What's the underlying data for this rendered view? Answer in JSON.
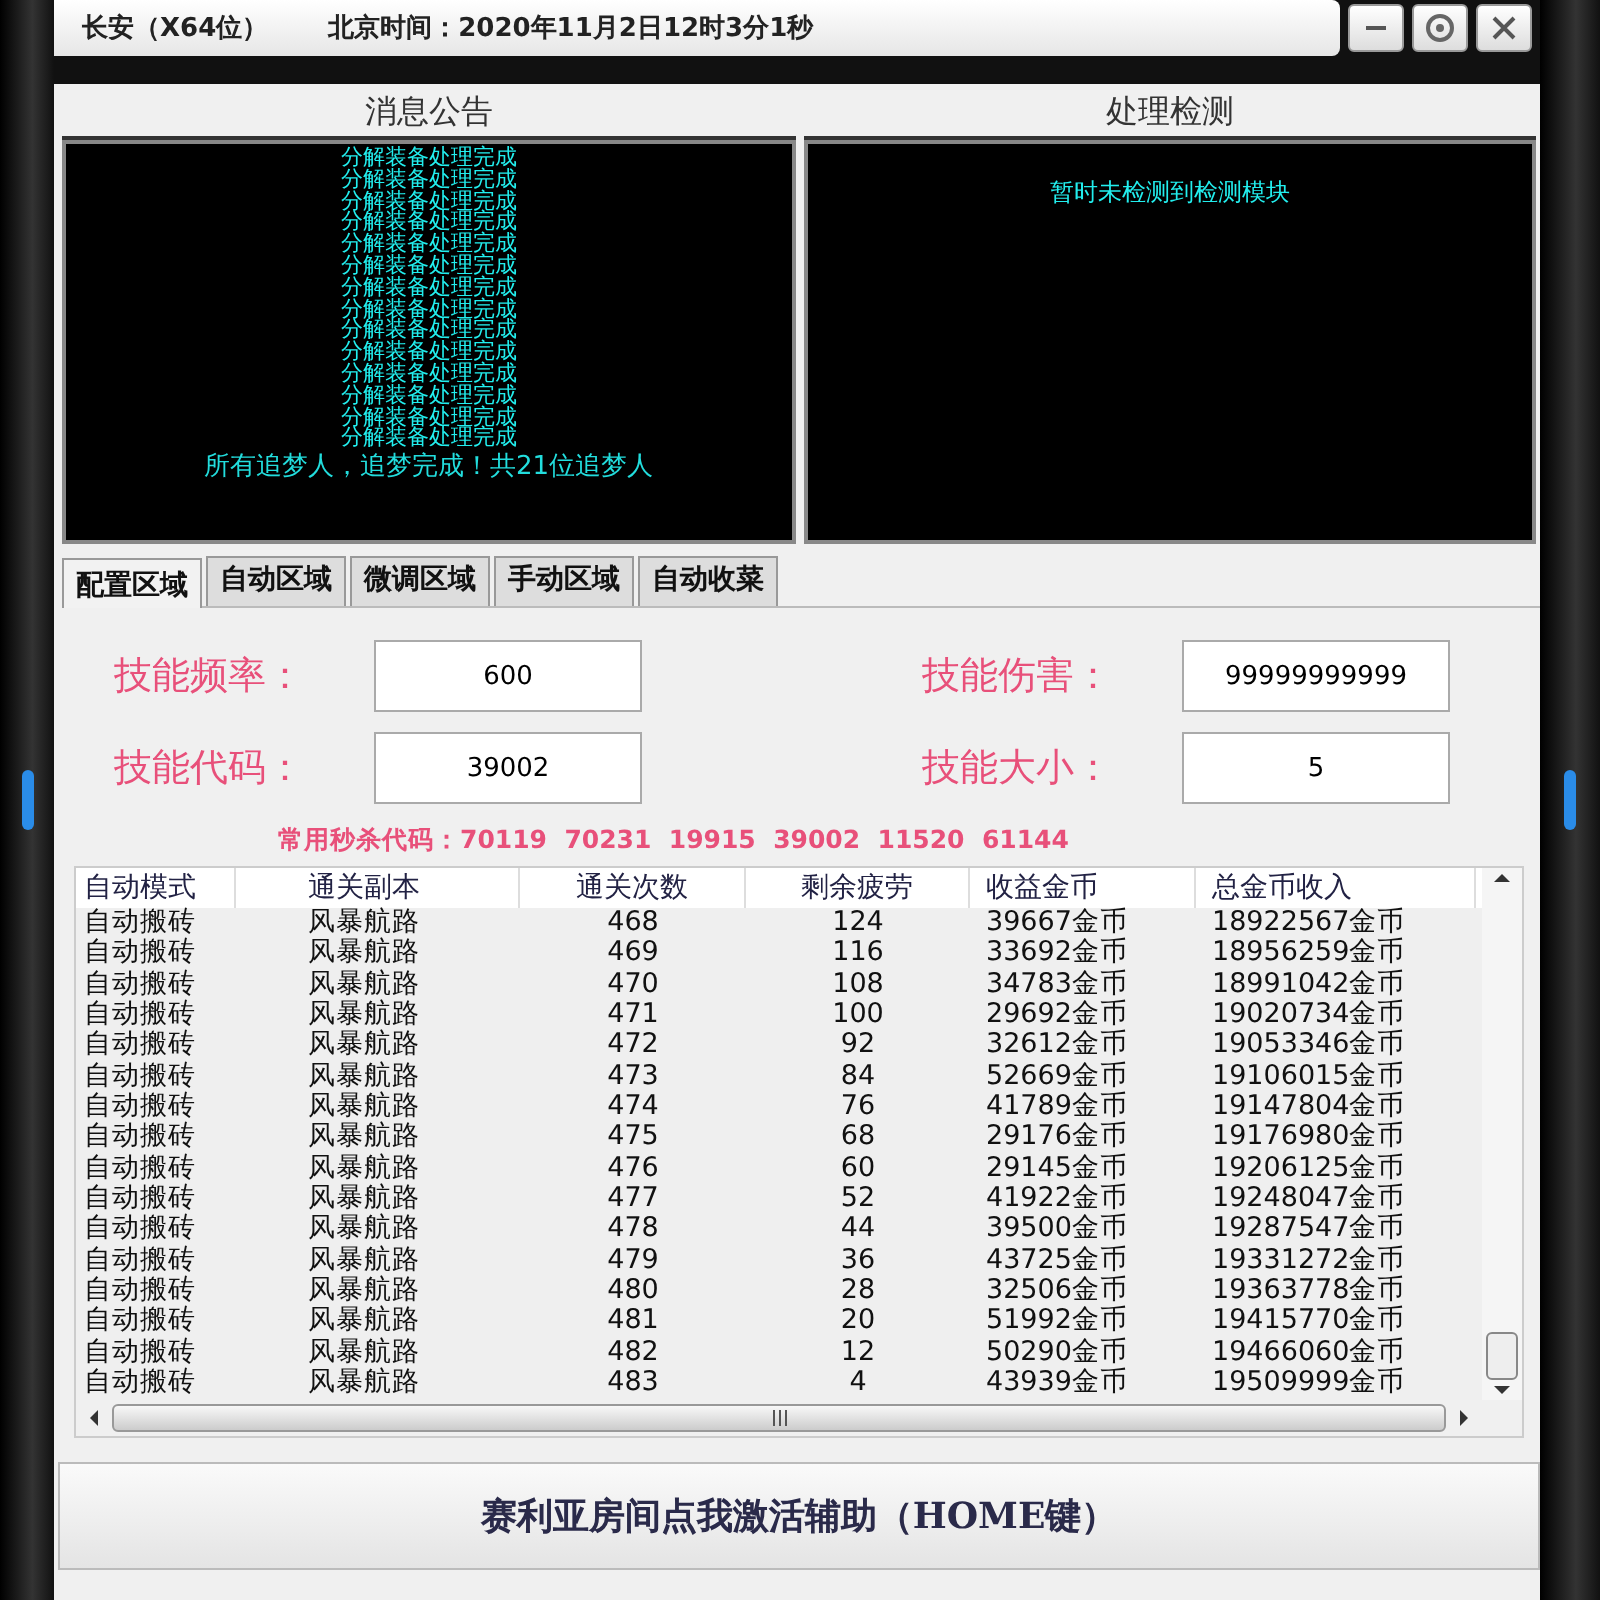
{
  "window": {
    "title": "长安（X64位）",
    "clock": "北京时间：2020年11月2日12时3分1秒"
  },
  "panels": [
    {
      "title": "消息公告",
      "lines": [
        "分解装备处理完成",
        "分解装备处理完成",
        "分解装备处理完成",
        "分解装备处理完成",
        "分解装备处理完成",
        "分解装备处理完成",
        "分解装备处理完成",
        "分解装备处理完成",
        "分解装备处理完成",
        "分解装备处理完成",
        "分解装备处理完成",
        "分解装备处理完成",
        "分解装备处理完成",
        "分解装备处理完成"
      ],
      "footer": "所有追梦人，追梦完成！共21位追梦人"
    },
    {
      "title": "处理检测",
      "lines": [
        "暂时未检测到检测模块"
      ]
    }
  ],
  "tabs": [
    {
      "label": "配置区域",
      "selected": true
    },
    {
      "label": "自动区域",
      "selected": false
    },
    {
      "label": "微调区域",
      "selected": false
    },
    {
      "label": "手动区域",
      "selected": false
    },
    {
      "label": "自动收菜",
      "selected": false
    }
  ],
  "fields": [
    {
      "label": "技能频率：",
      "value": "600"
    },
    {
      "label": "技能伤害：",
      "value": "99999999999"
    },
    {
      "label": "技能代码：",
      "value": "39002"
    },
    {
      "label": "技能大小：",
      "value": "5"
    }
  ],
  "hint": "常用秒杀代码：70119  70231  19915  39002  11520  61144",
  "table": {
    "columns": [
      "自动模式",
      "通关副本",
      "通关次数",
      "剩余疲劳",
      "收益金币",
      "总金币收入"
    ],
    "rows": [
      [
        "自动搬砖",
        "风暴航路",
        "468",
        "124",
        "39667金币",
        "18922567金币"
      ],
      [
        "自动搬砖",
        "风暴航路",
        "469",
        "116",
        "33692金币",
        "18956259金币"
      ],
      [
        "自动搬砖",
        "风暴航路",
        "470",
        "108",
        "34783金币",
        "18991042金币"
      ],
      [
        "自动搬砖",
        "风暴航路",
        "471",
        "100",
        "29692金币",
        "19020734金币"
      ],
      [
        "自动搬砖",
        "风暴航路",
        "472",
        "92",
        "32612金币",
        "19053346金币"
      ],
      [
        "自动搬砖",
        "风暴航路",
        "473",
        "84",
        "52669金币",
        "19106015金币"
      ],
      [
        "自动搬砖",
        "风暴航路",
        "474",
        "76",
        "41789金币",
        "19147804金币"
      ],
      [
        "自动搬砖",
        "风暴航路",
        "475",
        "68",
        "29176金币",
        "19176980金币"
      ],
      [
        "自动搬砖",
        "风暴航路",
        "476",
        "60",
        "29145金币",
        "19206125金币"
      ],
      [
        "自动搬砖",
        "风暴航路",
        "477",
        "52",
        "41922金币",
        "19248047金币"
      ],
      [
        "自动搬砖",
        "风暴航路",
        "478",
        "44",
        "39500金币",
        "19287547金币"
      ],
      [
        "自动搬砖",
        "风暴航路",
        "479",
        "36",
        "43725金币",
        "19331272金币"
      ],
      [
        "自动搬砖",
        "风暴航路",
        "480",
        "28",
        "32506金币",
        "19363778金币"
      ],
      [
        "自动搬砖",
        "风暴航路",
        "481",
        "20",
        "51992金币",
        "19415770金币"
      ],
      [
        "自动搬砖",
        "风暴航路",
        "482",
        "12",
        "50290金币",
        "19466060金币"
      ],
      [
        "自动搬砖",
        "风暴航路",
        "483",
        "4",
        "43939金币",
        "19509999金币"
      ]
    ]
  },
  "activate_button": "赛利亚房间点我激活辅助（HOME键）"
}
